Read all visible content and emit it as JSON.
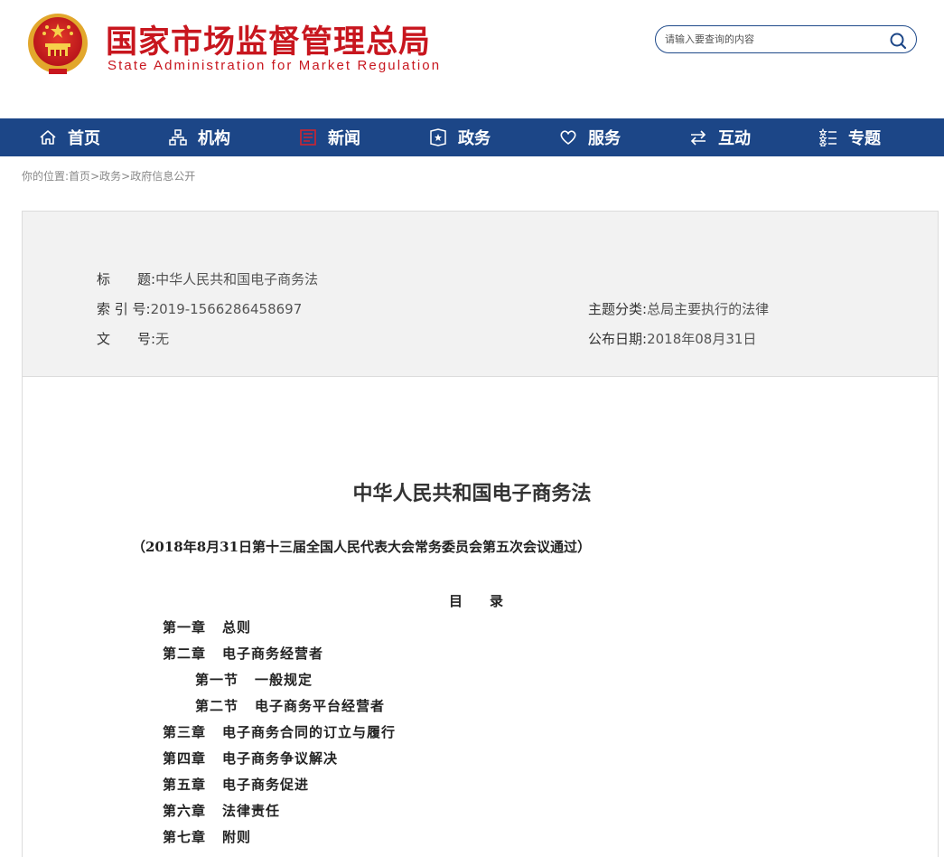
{
  "header": {
    "title": "国家市场监督管理总局",
    "subtitle": "State Administration for Market Regulation",
    "search_placeholder": "请输入要查询的内容"
  },
  "nav": [
    {
      "label": "首页",
      "icon": "home-icon"
    },
    {
      "label": "机构",
      "icon": "org-chart-icon"
    },
    {
      "label": "新闻",
      "icon": "news-icon"
    },
    {
      "label": "政务",
      "icon": "government-icon"
    },
    {
      "label": "服务",
      "icon": "heart-icon"
    },
    {
      "label": "互动",
      "icon": "arrows-icon"
    },
    {
      "label": "专题",
      "icon": "stars-list-icon"
    }
  ],
  "breadcrumb": {
    "prefix": "你的位置:",
    "items": [
      "首页",
      "政务",
      "政府信息公开"
    ],
    "sep": ">"
  },
  "info": {
    "title_label": "标　　题:",
    "title_value": "中华人民共和国电子商务法",
    "index_label": "索 引 号:",
    "index_value": "2019-1566286458697",
    "category_label": "主题分类:",
    "category_value": "总局主要执行的法律",
    "docno_label": "文　　号:",
    "docno_value": "无",
    "date_label": "公布日期:",
    "date_value": "2018年08月31日"
  },
  "document": {
    "title": "中华人民共和国电子商务法",
    "subtitle": "（2018年8月31日第十三届全国人民代表大会常务委员会第五次会议通过）",
    "toc_heading": "目录",
    "toc": [
      {
        "chapter": "第一章",
        "name": "总则"
      },
      {
        "chapter": "第二章",
        "name": "电子商务经营者"
      },
      {
        "chapter": "第一节",
        "name": "一般规定"
      },
      {
        "chapter": "第二节",
        "name": "电子商务平台经营者"
      },
      {
        "chapter": "第三章",
        "name": "电子商务合同的订立与履行"
      },
      {
        "chapter": "第四章",
        "name": "电子商务争议解决"
      },
      {
        "chapter": "第五章",
        "name": "电子商务促进"
      },
      {
        "chapter": "第六章",
        "name": "法律责任"
      },
      {
        "chapter": "第七章",
        "name": "附则"
      }
    ]
  },
  "colors": {
    "brand_red": "#c8161e",
    "nav_blue": "#1c4687",
    "active_red": "#d0232e"
  }
}
